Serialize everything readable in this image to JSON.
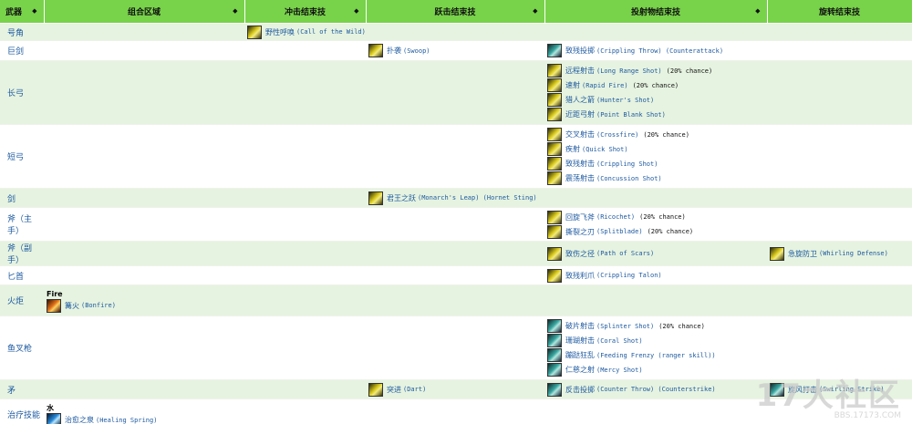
{
  "headers": {
    "weapon": "武器",
    "combo": "组合区域",
    "charge": "冲击结束技",
    "leap": "跃击结束技",
    "projectile": "投射物结束技",
    "whirl": "旋转结束技"
  },
  "rows": {
    "horn": {
      "weapon": "号角",
      "charge": [
        {
          "zh": "野性呼唤",
          "en": "(Call of the Wild)"
        }
      ]
    },
    "greatsword": {
      "weapon": "巨剑",
      "leap": [
        {
          "zh": "扑袭",
          "en": "(Swoop)"
        }
      ],
      "projectile": [
        {
          "zh": "致残投掷",
          "en": "(Crippling Throw) (Counterattack)"
        }
      ]
    },
    "longbow": {
      "weapon": "长弓",
      "projectile": [
        {
          "zh": "远程射击",
          "en": "(Long Range Shot)",
          "note": "(20% chance)"
        },
        {
          "zh": "速射",
          "en": "(Rapid Fire)",
          "note": "(20% chance)"
        },
        {
          "zh": "猎人之箭",
          "en": "(Hunter's Shot)"
        },
        {
          "zh": "近距弓射",
          "en": "(Point Blank Shot)"
        }
      ]
    },
    "shortbow": {
      "weapon": "短弓",
      "projectile": [
        {
          "zh": "交叉射击",
          "en": "(Crossfire)",
          "note": "(20% chance)"
        },
        {
          "zh": "疾射",
          "en": "(Quick Shot)"
        },
        {
          "zh": "致残射击",
          "en": "(Crippling Shot)"
        },
        {
          "zh": "震荡射击",
          "en": "(Concussion Shot)"
        }
      ]
    },
    "sword": {
      "weapon": "剑",
      "leap": [
        {
          "zh": "君王之跃",
          "en": "(Monarch's Leap) (Hornet Sting)"
        }
      ]
    },
    "axemain": {
      "weapon": "斧（主手）",
      "projectile": [
        {
          "zh": "回旋飞斧",
          "en": "(Ricochet)",
          "note": "(20% chance)"
        },
        {
          "zh": "撕裂之刃",
          "en": "(Splitblade)",
          "note": "(20% chance)"
        }
      ]
    },
    "axeoff": {
      "weapon": "斧（副手）",
      "projectile": [
        {
          "zh": "致伤之径",
          "en": "(Path of Scars)"
        }
      ],
      "whirl": [
        {
          "zh": "急旋防卫",
          "en": "(Whirling Defense)"
        }
      ]
    },
    "dagger": {
      "weapon": "匕首",
      "projectile": [
        {
          "zh": "致残利爪",
          "en": "(Crippling Talon)"
        }
      ]
    },
    "torch": {
      "weapon": "火炬",
      "combo_label": "Fire",
      "combo": [
        {
          "zh": "篝火",
          "en": "(Bonfire)"
        }
      ]
    },
    "speargun": {
      "weapon": "鱼叉枪",
      "projectile": [
        {
          "zh": "破片射击",
          "en": "(Splinter Shot)",
          "note": "(20% chance)"
        },
        {
          "zh": "珊瑚射击",
          "en": "(Coral Shot)"
        },
        {
          "zh": "蹦跶狂乱",
          "en": "(Feeding Frenzy (ranger skill))"
        },
        {
          "zh": "仁慈之射",
          "en": "(Mercy Shot)"
        }
      ]
    },
    "spear": {
      "weapon": "矛",
      "leap": [
        {
          "zh": "突进",
          "en": "(Dart)"
        }
      ],
      "projectile": [
        {
          "zh": "反击投掷",
          "en": "(Counter Throw) (Counterstrike)"
        }
      ],
      "whirl": [
        {
          "zh": "旋风打击",
          "en": "(Swirling Strike)"
        }
      ]
    },
    "healing": {
      "weapon": "治疗技能",
      "combo_label": "水",
      "combo": [
        {
          "zh": "治愈之泉",
          "en": "(Healing Spring)"
        }
      ]
    }
  },
  "watermark": {
    "big": "17大社区",
    "small": "BBS.17173.COM"
  }
}
